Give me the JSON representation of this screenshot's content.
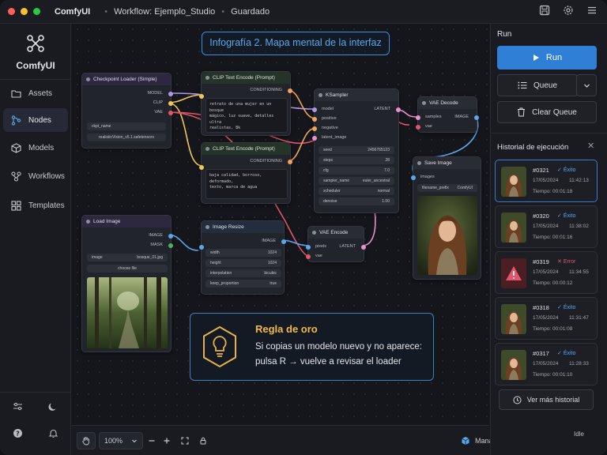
{
  "titlebar": {
    "app_name": "ComfyUI",
    "workflow": "Workflow: Ejemplo_Studio",
    "saved": "Guardado",
    "dot_colors": [
      "#ff5f57",
      "#febc2e",
      "#28c840"
    ]
  },
  "sidebar": {
    "logo_text": "ComfyUI",
    "items": [
      {
        "label": "Assets",
        "icon": "folder-icon",
        "active": false
      },
      {
        "label": "Nodes",
        "icon": "nodes-icon",
        "active": true
      },
      {
        "label": "Models",
        "icon": "cube-icon",
        "active": false
      },
      {
        "label": "Workflows",
        "icon": "workflow-icon",
        "active": false
      },
      {
        "label": "Templates",
        "icon": "grid-icon",
        "active": false
      }
    ]
  },
  "headline": "Infografía 2. Mapa mental de la interfaz",
  "nodes": {
    "checkpoint": {
      "title": "Checkpoint Loader (Simple)",
      "outputs": [
        "MODEL",
        "CLIP",
        "VAE"
      ],
      "widget_label": "ckpt_name",
      "widget_value": "realisticVision_v5.1.safetensors"
    },
    "clip_pos": {
      "title": "CLIP Text Encode (Prompt)",
      "output": "CONDITIONING",
      "text_lines": [
        "retrato de una mujer en un bosque",
        "mágico, luz suave, detalles ultra",
        "realistas, 8k"
      ]
    },
    "clip_neg": {
      "title": "CLIP Text Encode (Prompt)",
      "output": "CONDITIONING",
      "text_lines": [
        "baja calidad, borroso, deformado,",
        "texto, marca de agua"
      ]
    },
    "ksampler": {
      "title": "KSampler",
      "inputs": [
        "model",
        "positive",
        "negative",
        "latent_image"
      ],
      "output": "LATENT",
      "widgets": [
        {
          "label": "seed",
          "value": "2456765123"
        },
        {
          "label": "steps",
          "value": "28"
        },
        {
          "label": "cfg",
          "value": "7.0"
        },
        {
          "label": "sampler_name",
          "value": "euler_ancestral"
        },
        {
          "label": "scheduler",
          "value": "normal"
        },
        {
          "label": "denoise",
          "value": "1.00"
        }
      ]
    },
    "vae_decode": {
      "title": "VAE Decode",
      "inputs": [
        "samples",
        "vae"
      ],
      "output": "IMAGE"
    },
    "save_image": {
      "title": "Save Image",
      "input": "images",
      "widget_label": "filename_prefix",
      "widget_value": "ComfyUI"
    },
    "load_image": {
      "title": "Load Image",
      "outputs": [
        "IMAGE",
        "MASK"
      ],
      "widget_label": "image",
      "widget_value": "bosque_01.jpg",
      "button": "choose file"
    },
    "image_resize": {
      "title": "Image Resize",
      "output": "IMAGE",
      "widgets": [
        {
          "label": "width",
          "value": "1024"
        },
        {
          "label": "height",
          "value": "1024"
        },
        {
          "label": "interpolation",
          "value": "bicubic"
        },
        {
          "label": "keep_proportion",
          "value": "true"
        }
      ]
    },
    "vae_encode": {
      "title": "VAE Encode",
      "inputs": [
        "pixels",
        "vae"
      ],
      "output": "LATENT"
    }
  },
  "tip": {
    "title": "Regla de oro",
    "line1": "Si copias un modelo nuevo y no aparece:",
    "line2": "pulsa R → vuelve a revisar el loader",
    "icon": "lightbulb-icon"
  },
  "bottombar": {
    "zoom": "100%",
    "manager": "Manager",
    "status": "Idle"
  },
  "run_panel": {
    "title": "Run",
    "run_label": "Run",
    "queue_label": "Queue",
    "clear_label": "Clear Queue",
    "accent": "#2f7fd6"
  },
  "history": {
    "title": "Historial de ejecución",
    "items": [
      {
        "id": "#0321",
        "status": "Éxito",
        "ok": true,
        "date": "17/05/2024",
        "time": "11:42:13",
        "duration": "Tiempo: 00:01:18"
      },
      {
        "id": "#0320",
        "status": "Éxito",
        "ok": true,
        "date": "17/05/2024",
        "time": "11:38:02",
        "duration": "Tiempo: 00:01:16"
      },
      {
        "id": "#0319",
        "status": "Error",
        "ok": false,
        "date": "17/05/2024",
        "time": "11:34:55",
        "duration": "Tiempo: 00:00:12"
      },
      {
        "id": "#0318",
        "status": "Éxito",
        "ok": true,
        "date": "17/05/2024",
        "time": "11:31:47",
        "duration": "Tiempo: 00:01:08"
      },
      {
        "id": "#0317",
        "status": "Éxito",
        "ok": true,
        "date": "17/05/2024",
        "time": "11:28:33",
        "duration": "Tiempo: 00:01:10"
      }
    ],
    "more_label": "Ver más historial"
  }
}
